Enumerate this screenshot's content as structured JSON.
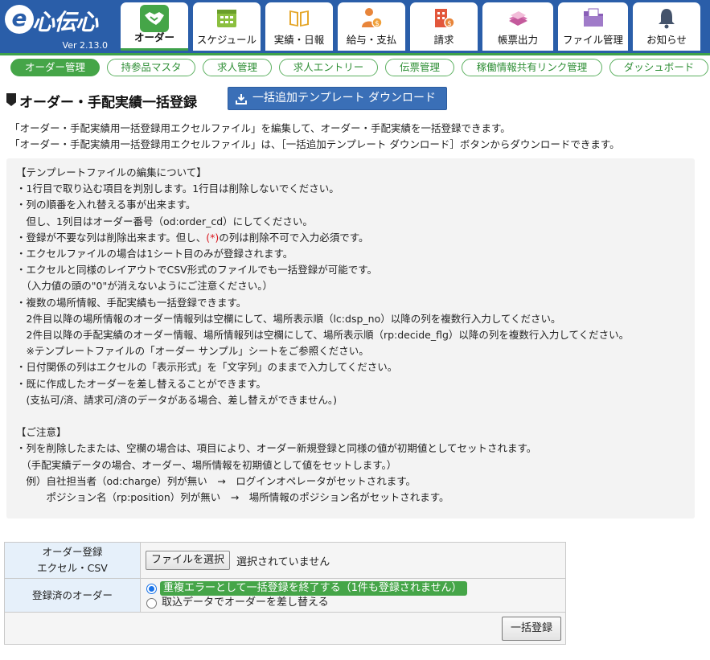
{
  "app": {
    "logo_e": "e",
    "logo_name": "心伝心",
    "version": "Ver 2.13.0"
  },
  "tabs": [
    {
      "label": "オーダー",
      "icon": "handshake-icon",
      "active": true
    },
    {
      "label": "スケジュール",
      "icon": "calendar-icon"
    },
    {
      "label": "実績・日報",
      "icon": "open-book-icon"
    },
    {
      "label": "給与・支払",
      "icon": "person-money-icon"
    },
    {
      "label": "請求",
      "icon": "building-money-icon"
    },
    {
      "label": "帳票出力",
      "icon": "documents-icon"
    },
    {
      "label": "ファイル管理",
      "icon": "folder-icon"
    },
    {
      "label": "お知らせ",
      "icon": "bell-icon"
    }
  ],
  "subnav": [
    {
      "label": "オーダー管理",
      "active": true
    },
    {
      "label": "持参品マスタ"
    },
    {
      "label": "求人管理"
    },
    {
      "label": "求人エントリー"
    },
    {
      "label": "伝票管理"
    },
    {
      "label": "稼働情報共有リンク管理"
    },
    {
      "label": "ダッシュボード"
    }
  ],
  "page": {
    "title": "オーダー・手配実績一括登録",
    "download_button": "一括追加テンプレート ダウンロード",
    "intro": [
      "「オーダー・手配実績用一括登録用エクセルファイル」を編集して、オーダー・手配実績を一括登録できます。",
      "「オーダー・手配実績用一括登録用エクセルファイル」は、［一括追加テンプレート ダウンロード］ボタンからダウンロードできます。"
    ]
  },
  "info": {
    "lines": [
      "【テンプレートファイルの編集について】",
      "・1行目で取り込む項目を判別します。1行目は削除しないでください。",
      "・列の順番を入れ替える事が出来ます。",
      "　但し、1列目はオーダー番号（od:order_cd）にしてください。",
      "・登録が不要な列は削除出来ます。但し、",
      "・エクセルファイルの場合は1シート目のみが登録されます。",
      "・エクセルと同様のレイアウトでCSV形式のファイルでも一括登録が可能です。",
      "　（入力値の頭の\"0\"が消えないようにご注意ください。）",
      "・複数の場所情報、手配実績も一括登録できます。",
      "　2件目以降の場所情報のオーダー情報列は空欄にして、場所表示順（lc:dsp_no）以降の列を複数行入力してください。",
      "　2件目以降の手配実績のオーダー情報、場所情報列は空欄にして、場所表示順（rp:decide_flg）以降の列を複数行入力してください。",
      "　※テンプレートファイルの「オーダー サンプル」シートをご参照ください。",
      "・日付関係の列はエクセルの「表示形式」を「文字列」のままで入力してください。",
      "・既に作成したオーダーを差し替えることができます。",
      "　(支払可/済、請求可/済のデータがある場合、差し替えができません。)",
      "",
      "【ご注意】",
      "・列を削除したまたは、空欄の場合は、項目により、オーダー新規登録と同様の値が初期値としてセットされます。",
      "　（手配実績データの場合、オーダー、場所情報を初期値として値をセットします。）",
      "　例）自社担当者（od:charge）列が無い　→　ログインオペレータがセットされます。",
      "　　　ポジション名（rp:position）列が無い　→　場所情報のポジション名がセットされます。"
    ],
    "req_mark": "(*)",
    "req_suffix": "の列は削除不可で入力必須です。"
  },
  "form": {
    "file_label_1": "オーダー登録",
    "file_label_2": "エクセル・CSV",
    "file_button": "ファイルを選択",
    "file_status": "選択されていません",
    "registered_label": "登録済のオーダー",
    "option_1": "重複エラーとして一括登録を終了する（1件も登録されません）",
    "option_2": "取込データでオーダーを差し替える",
    "selected_option": 1,
    "submit": "一括登録"
  },
  "colors": {
    "header_blue": "#2a5ea9",
    "accent_green": "#45a548",
    "button_blue": "#3a6fb7",
    "required_red": "#d9141b"
  }
}
